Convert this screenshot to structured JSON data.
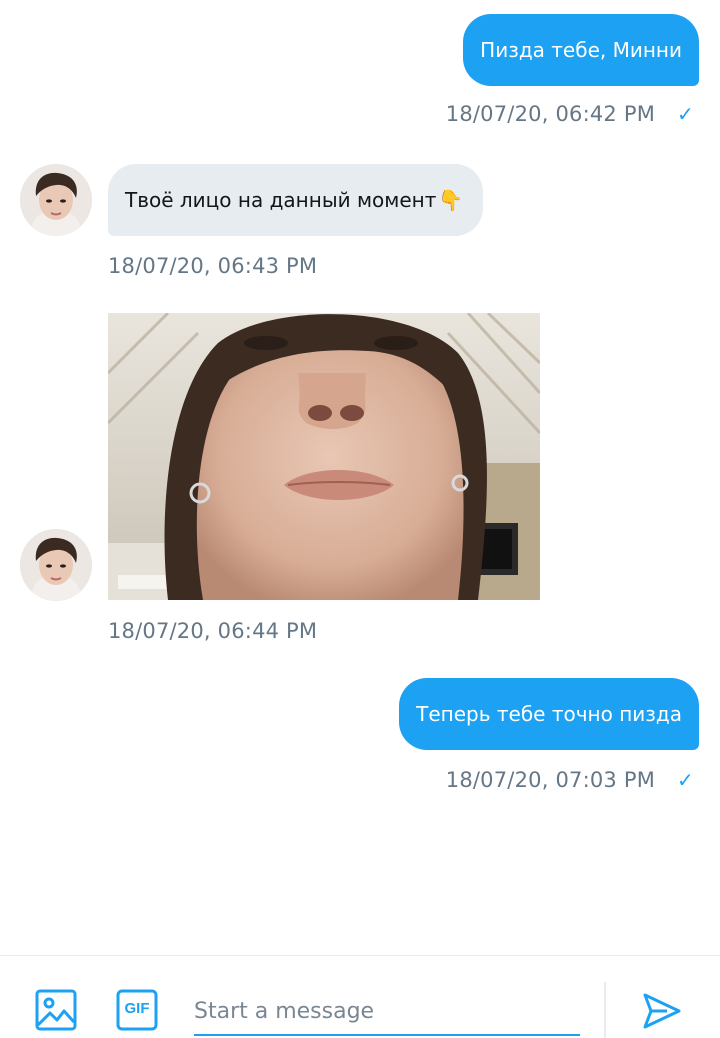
{
  "messages": [
    {
      "direction": "out",
      "text": "Пизда тебе, Минни",
      "time": "18/07/20, 06:42 PM",
      "read_icon": "check-icon"
    },
    {
      "direction": "in",
      "text": "Твоё лицо на данный момент",
      "emoji": "👇",
      "time": "18/07/20, 06:43 PM"
    },
    {
      "direction": "in",
      "type": "image",
      "time": "18/07/20, 06:44 PM"
    },
    {
      "direction": "out",
      "text": "Теперь тебе точно пизда",
      "time": "18/07/20, 07:03 PM",
      "read_icon": "check-icon"
    }
  ],
  "read_mark": "✓",
  "composer": {
    "placeholder": "Start a message",
    "gif_label": "GIF"
  },
  "colors": {
    "accent": "#1da1f2",
    "incoming_bubble": "#e6ecf0",
    "timestamp": "#657786"
  }
}
